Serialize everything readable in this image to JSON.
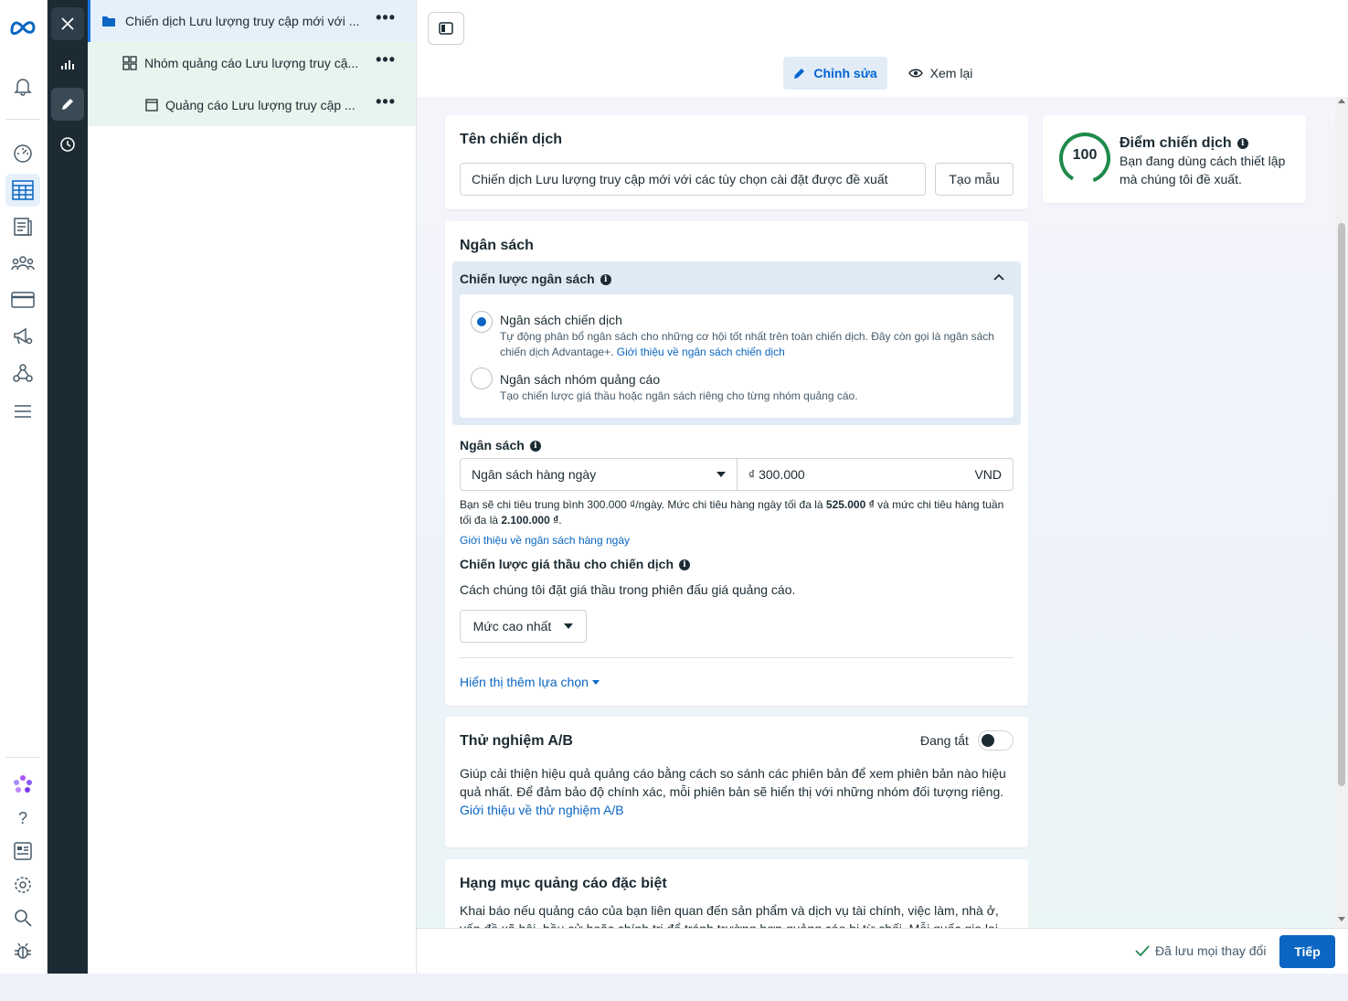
{
  "tree": {
    "campaign": "Chiến dịch Lưu lượng truy cập mới với ...",
    "adset": "Nhóm quảng cáo Lưu lượng truy cậ...",
    "ad": "Quảng cáo Lưu lượng truy cập ..."
  },
  "tabs": {
    "edit": "Chỉnh sửa",
    "review": "Xem lại"
  },
  "campaign_name": {
    "title": "Tên chiến dịch",
    "value": "Chiến dịch Lưu lượng truy cập mới với các tùy chọn cài đặt được đề xuất",
    "template_btn": "Tạo mẫu"
  },
  "budget": {
    "title": "Ngân sách",
    "strategy_title": "Chiến lược ngân sách",
    "opt1_title": "Ngân sách chiến dịch",
    "opt1_desc": "Tự động phân bổ ngân sách cho những cơ hội tốt nhất trên toàn chiến dịch. Đây còn gọi là ngân sách chiến dịch Advantage+.",
    "opt1_link": "Giới thiệu về ngân sách chiến dịch",
    "opt2_title": "Ngân sách nhóm quảng cáo",
    "opt2_desc": "Tạo chiến lược giá thầu hoặc ngân sách riêng cho từng nhóm quảng cáo.",
    "budget_label": "Ngân sách",
    "budget_type": "Ngân sách hàng ngày",
    "currency_symbol": "₫",
    "amount": "300.000",
    "currency": "VND",
    "spend_note_1": "Bạn sẽ chi tiêu trung bình 300.000 ₫/ngày. Mức chi tiêu hàng ngày tối đa là",
    "spend_daily_max": "525.000 ₫",
    "spend_note_2": "và mức chi tiêu hàng tuần tối đa là",
    "spend_weekly_max": "2.100.000 ₫",
    "spend_note_end": ".",
    "daily_link": "Giới thiệu về ngân sách hàng ngày",
    "bid_title": "Chiến lược giá thầu cho chiến dịch",
    "bid_desc": "Cách chúng tôi đặt giá thầu trong phiên đấu giá quảng cáo.",
    "bid_value": "Mức cao nhất",
    "more_options": "Hiển thị thêm lựa chọn"
  },
  "ab_test": {
    "title": "Thử nghiệm A/B",
    "status": "Đang tắt",
    "desc": "Giúp cải thiện hiệu quả quảng cáo bằng cách so sánh các phiên bản để xem phiên bản nào hiệu quả nhất. Để đảm bảo độ chính xác, mỗi phiên bản sẽ hiển thị với những nhóm đối tượng riêng.",
    "link": "Giới thiệu về thử nghiệm A/B"
  },
  "special": {
    "title": "Hạng mục quảng cáo đặc biệt",
    "desc": "Khai báo nếu quảng cáo của bạn liên quan đến sản phẩm và dịch vụ tài chính, việc làm, nhà ở, vấn đề xã hội, bầu cử hoặc chính trị để tránh trường hợp quảng cáo bị từ chối. Mỗi quốc gia lại có"
  },
  "score": {
    "value": "100",
    "title": "Điểm chiến dịch",
    "desc": "Bạn đang dùng cách thiết lập mà chúng tôi đề xuất."
  },
  "footer": {
    "saved": "Đã lưu mọi thay đổi",
    "next": "Tiếp"
  },
  "colors": {
    "accent": "#0a66c2",
    "score_ring": "#1f8a4c",
    "rail": "#1c2b33"
  }
}
